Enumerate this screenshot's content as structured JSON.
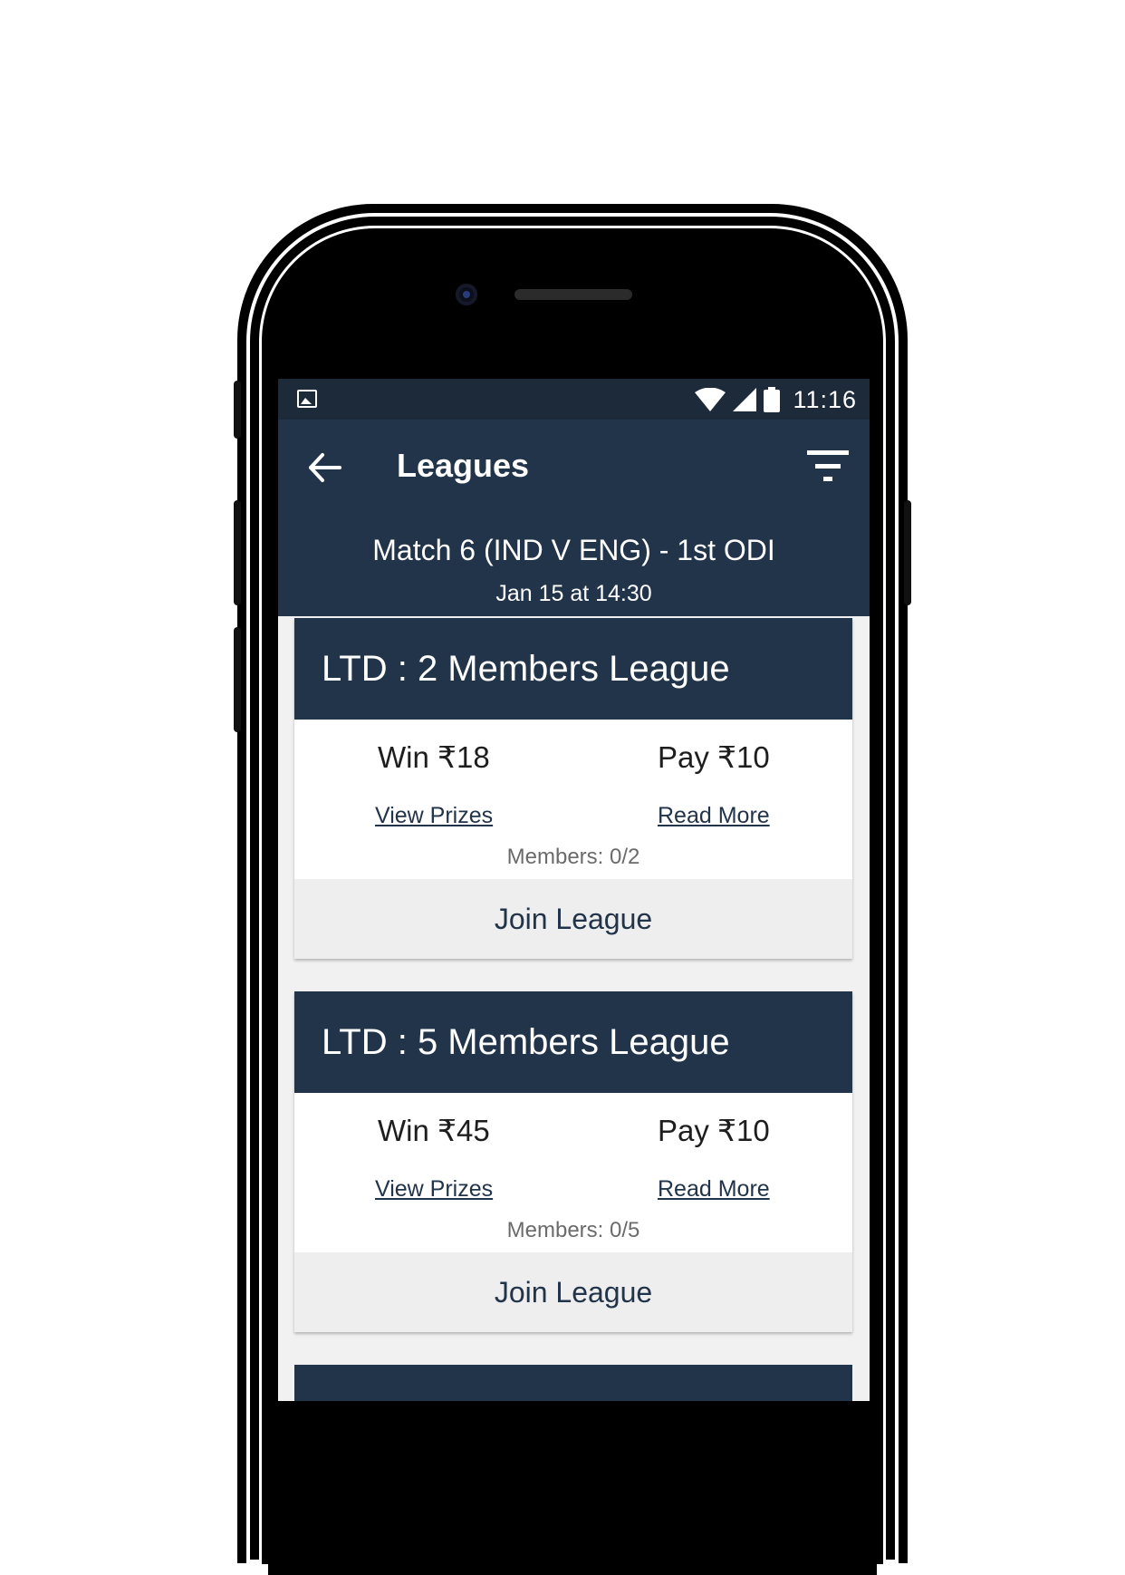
{
  "status_bar": {
    "time": "11:16",
    "icons": [
      "image-icon",
      "wifi-icon",
      "signal-icon",
      "battery-icon"
    ]
  },
  "app_bar": {
    "title": "Leagues",
    "back_icon": "arrow-left-icon",
    "filter_icon": "filter-icon"
  },
  "match": {
    "title": "Match 6 (IND V ENG) - 1st ODI",
    "time": "Jan 15 at 14:30"
  },
  "leagues": [
    {
      "title": "LTD : 2 Members League",
      "win": "Win ₹18",
      "pay": "Pay ₹10",
      "view_prizes": "View Prizes",
      "read_more": "Read More",
      "members": "Members: 0/2",
      "join": "Join League"
    },
    {
      "title": "LTD : 5 Members League",
      "win": "Win ₹45",
      "pay": "Pay ₹10",
      "view_prizes": "View Prizes",
      "read_more": "Read More",
      "members": "Members: 0/5",
      "join": "Join League"
    }
  ],
  "colors": {
    "primary": "#22344a",
    "status_bar": "#1c2a3a",
    "join_bg": "#eeeeee",
    "muted_text": "#6b6b6b"
  }
}
